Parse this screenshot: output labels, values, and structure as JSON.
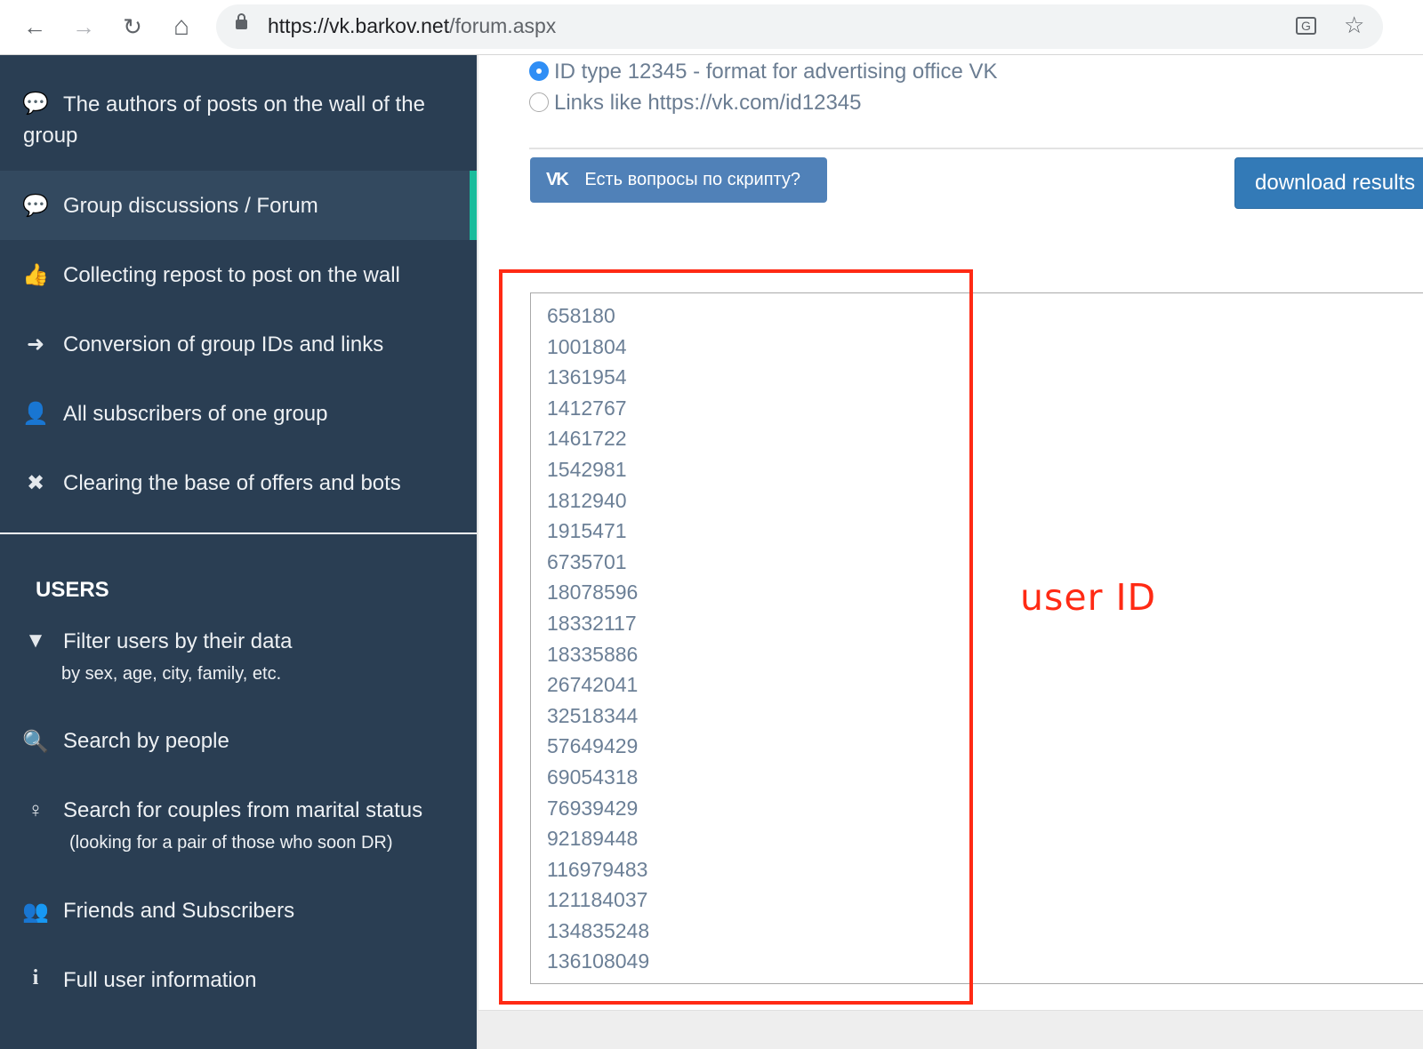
{
  "browser": {
    "url_host": "https://vk.barkov.net",
    "url_path": "/forum.aspx",
    "back_icon": "←",
    "forward_icon": "→",
    "reload_icon": "↻",
    "home_icon": "⌂",
    "translate_icon": "G",
    "star_icon": "☆"
  },
  "sidebar": {
    "items": [
      {
        "label": "The authors of posts on the wall of the",
        "label2": "group",
        "icon": "💬"
      },
      {
        "label": "Group discussions / Forum",
        "icon": "💬",
        "active": true
      },
      {
        "label": "Collecting repost to post on the wall",
        "icon": "👍"
      },
      {
        "label": "Conversion of group IDs and links",
        "icon": "➜"
      },
      {
        "label": "All subscribers of one group",
        "icon": "👤"
      },
      {
        "label": "Clearing the base of offers and bots",
        "icon": "✖"
      }
    ],
    "users_heading": "USERS",
    "user_items": [
      {
        "label": "Filter users by their data",
        "sub": "by sex, age, city, family, etc.",
        "icon": "▼"
      },
      {
        "label": "Search by people",
        "icon": "🔍"
      },
      {
        "label": "Search for couples from marital status",
        "sub": "(looking for a pair of those who soon DR)",
        "icon": "♀"
      },
      {
        "label": "Friends and Subscribers",
        "icon": "👥"
      },
      {
        "label": "Full user information",
        "icon": "i"
      }
    ]
  },
  "main": {
    "format_options": [
      {
        "label": "ID type 12345 - format for advertising office VK",
        "selected": true
      },
      {
        "label": "Links like https://vk.com/id12345",
        "selected": false
      }
    ],
    "vk_button": {
      "logo": "VK",
      "label": "Есть вопросы по скрипту?"
    },
    "download_button": "download results",
    "ids": [
      "658180",
      "1001804",
      "1361954",
      "1412767",
      "1461722",
      "1542981",
      "1812940",
      "1915471",
      "6735701",
      "18078596",
      "18332117",
      "18335886",
      "26742041",
      "32518344",
      "57649429",
      "69054318",
      "76939429",
      "92189448",
      "116979483",
      "121184037",
      "134835248",
      "136108049"
    ],
    "annotation": "user ID",
    "annotation_color": "#ff2a14"
  }
}
